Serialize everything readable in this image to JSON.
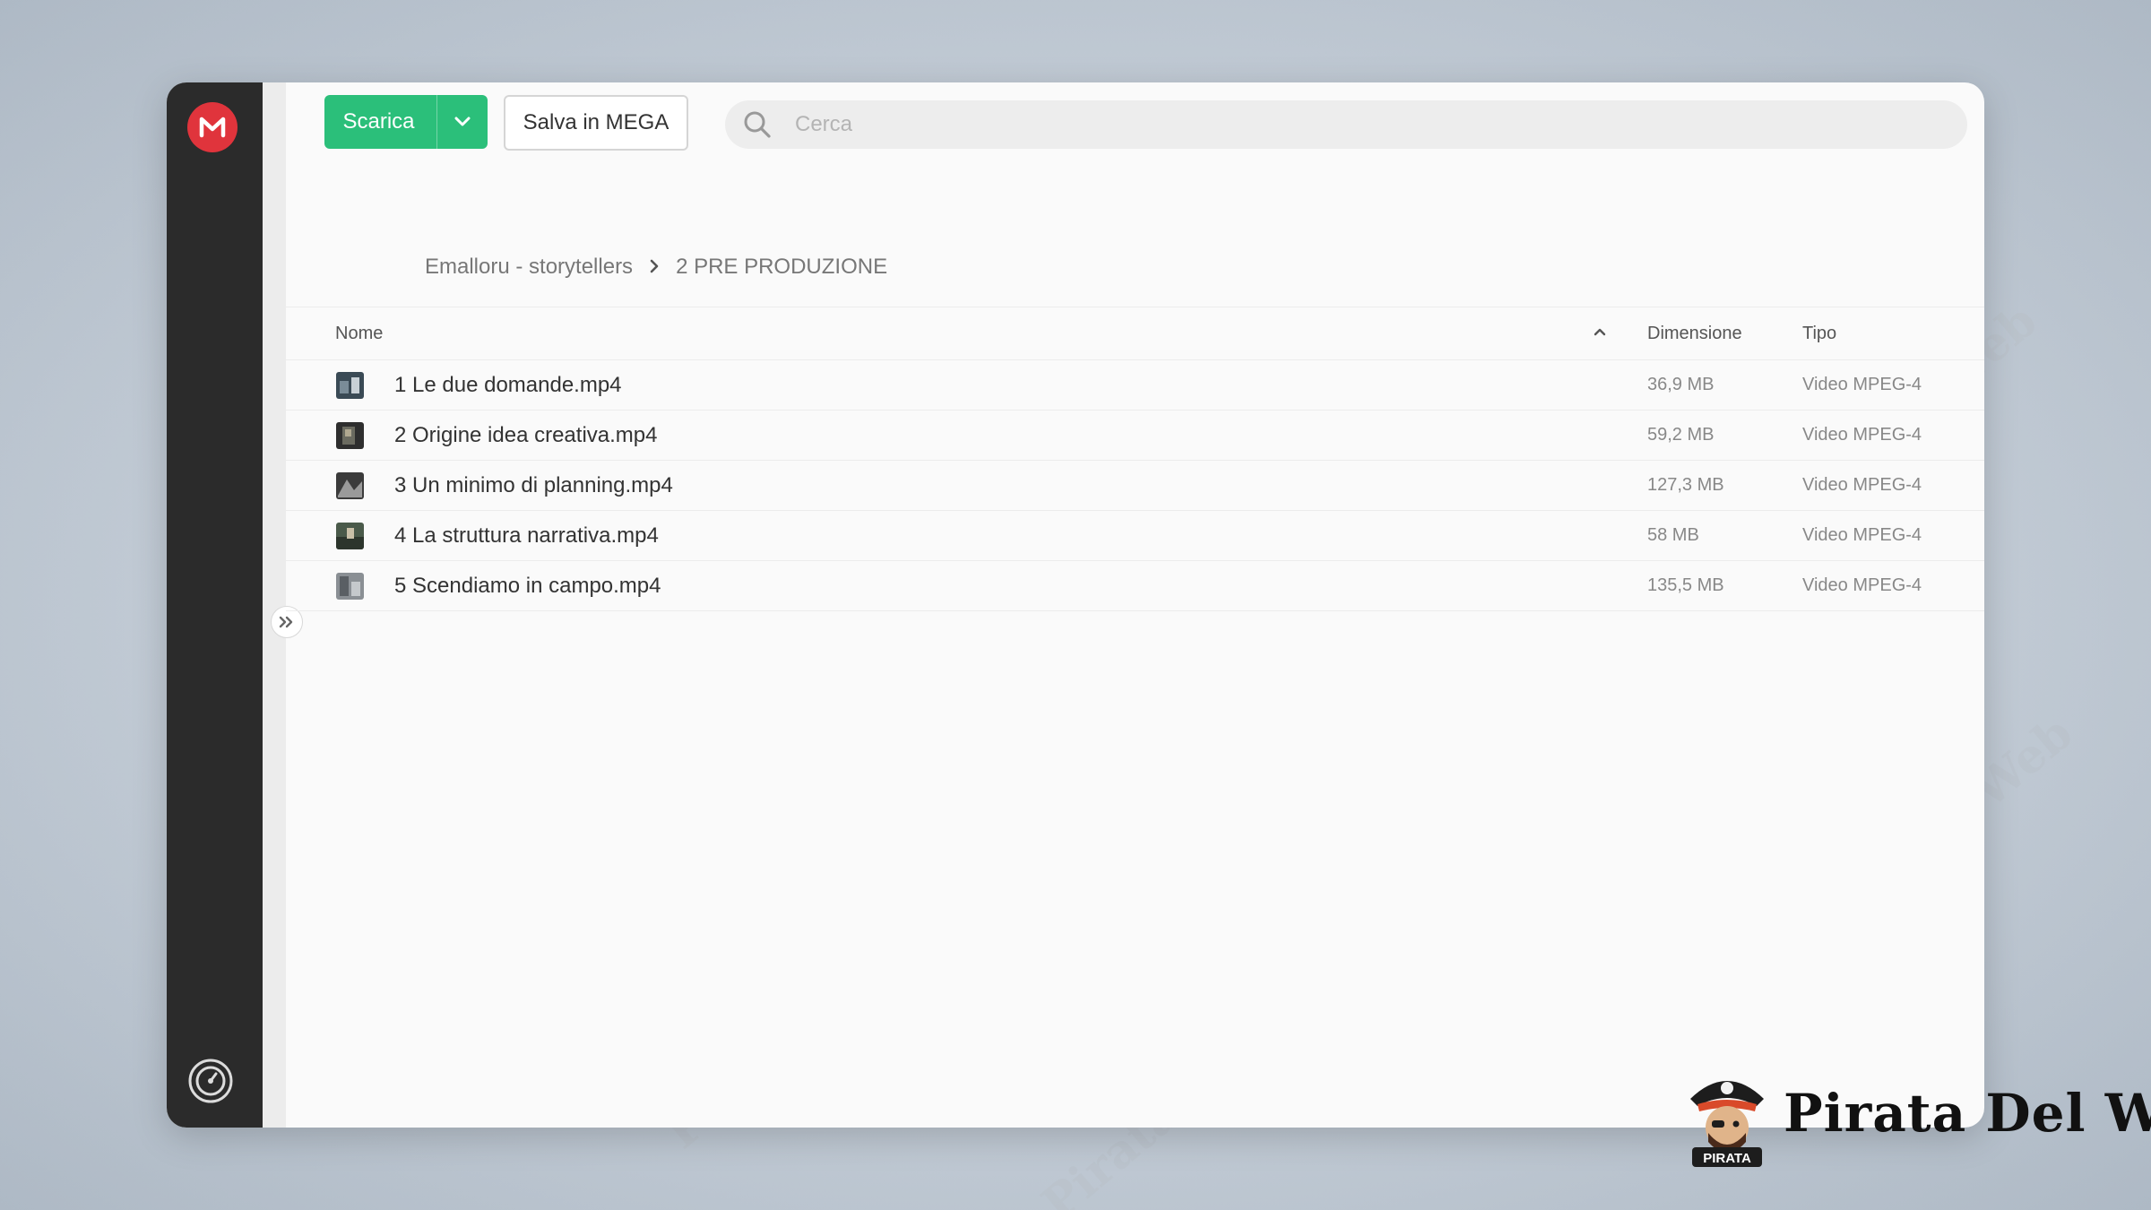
{
  "toolbar": {
    "download_label": "Scarica",
    "save_label": "Salva in MEGA"
  },
  "search": {
    "placeholder": "Cerca"
  },
  "breadcrumb": {
    "items": [
      "Emalloru - storytellers",
      "2 PRE PRODUZIONE"
    ]
  },
  "table": {
    "headers": {
      "name": "Nome",
      "size": "Dimensione",
      "type": "Tipo"
    },
    "sort": "name-ascending",
    "rows": [
      {
        "name": "1 Le due domande.mp4",
        "size": "36,9 MB",
        "type": "Video MPEG-4"
      },
      {
        "name": "2 Origine idea creativa.mp4",
        "size": "59,2 MB",
        "type": "Video MPEG-4"
      },
      {
        "name": "3 Un minimo di planning.mp4",
        "size": "127,3 MB",
        "type": "Video MPEG-4"
      },
      {
        "name": "4 La struttura narrativa.mp4",
        "size": "58 MB",
        "type": "Video MPEG-4"
      },
      {
        "name": "5 Scendiamo in campo.mp4",
        "size": "135,5 MB",
        "type": "Video MPEG-4"
      }
    ]
  },
  "watermark_text": "Pirata Del Web",
  "brand": {
    "name": "Pirata Del Web",
    "badge": "PIRATA"
  },
  "colors": {
    "accent": "#2bbf7a",
    "logo": "#e0343c",
    "sidebar": "#2b2b2b"
  },
  "icons": {
    "logo": "mega-logo-icon",
    "download_dropdown": "chevron-down-icon",
    "search": "search-icon",
    "breadcrumb_separator": "chevron-right-icon",
    "sort": "chevron-up-icon",
    "expand": "double-chevron-right-icon",
    "bottom": "speedometer-icon",
    "file": "video-thumbnail-icon"
  }
}
